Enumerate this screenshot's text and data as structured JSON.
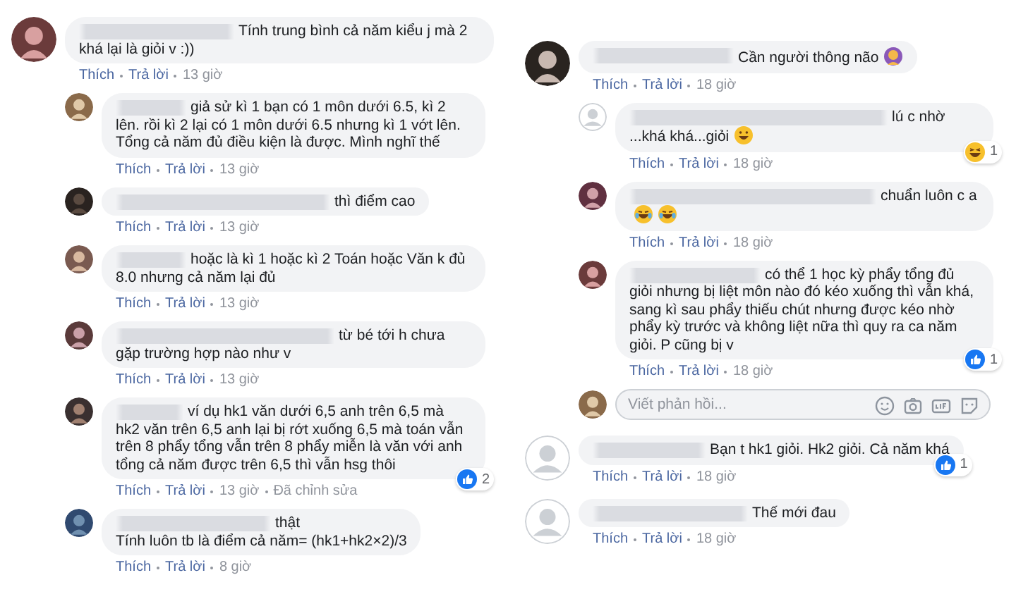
{
  "columns": [
    {
      "comments": [
        {
          "avatar": {
            "kind": "photo"
          },
          "text": "Tính trung bình cả năm kiểu j mà 2 khá lại là giỏi v :))",
          "actions": [
            "Thích",
            "Trả lời"
          ],
          "time": "13 giờ",
          "children": [
            {
              "avatar": {
                "kind": "photo"
              },
              "text": "giả sử kì 1 bạn có 1 môn dưới 6.5, kì 2 lên. rồi kì 2 lại có 1 môn dưới 6.5 nhưng kì 1 vớt lên. Tổng cả năm đủ điều kiện là được. Mình nghĩ thế",
              "actions": [
                "Thích",
                "Trả lời"
              ],
              "time": "13 giờ"
            },
            {
              "avatar": {
                "kind": "photo"
              },
              "text": "thì điểm cao",
              "actions": [
                "Thích",
                "Trả lời"
              ],
              "time": "13 giờ"
            },
            {
              "avatar": {
                "kind": "photo"
              },
              "text": "hoặc là kì 1 hoặc kì 2 Toán hoặc Văn k đủ 8.0 nhưng cả năm lại đủ",
              "actions": [
                "Thích",
                "Trả lời"
              ],
              "time": "13 giờ"
            },
            {
              "avatar": {
                "kind": "photo"
              },
              "text": "từ bé tới h chưa gặp trường hợp nào như v",
              "actions": [
                "Thích",
                "Trả lời"
              ],
              "time": "13 giờ"
            },
            {
              "avatar": {
                "kind": "photo"
              },
              "text": "ví dụ hk1 văn dưới 6,5 anh trên 6,5 mà hk2 văn trên 6,5 anh lại bị rớt xuống 6,5 mà toán vẫn trên 8 phẩy tổng vẫn trên 8 phẩy miễn là văn với anh tổng cả năm được trên 6,5 thì vẫn hsg thôi",
              "actions": [
                "Thích",
                "Trả lời"
              ],
              "time": "13 giờ",
              "edited": "Đã chỉnh sửa",
              "reaction": {
                "kind": "like",
                "count": "2"
              }
            },
            {
              "avatar": {
                "kind": "photo"
              },
              "text": "thật",
              "text2": "Tính luôn tb là điểm cả năm= (hk1+hk2×2)/3",
              "actions": [
                "Thích",
                "Trả lời"
              ],
              "time": "8 giờ"
            }
          ]
        }
      ]
    },
    {
      "comments": [
        {
          "avatar": {
            "kind": "photo"
          },
          "text": "Cần người thông não",
          "emojis": [
            {
              "kind": "person"
            }
          ],
          "actions": [
            "Thích",
            "Trả lời"
          ],
          "time": "18 giờ",
          "children": [
            {
              "avatar": {
                "kind": "default"
              },
              "text": "lú c nhờ ...khá khá...giỏi",
              "emojis": [
                {
                  "kind": "grin"
                }
              ],
              "actions": [
                "Thích",
                "Trả lời"
              ],
              "time": "18 giờ",
              "reaction": {
                "kind": "haha",
                "count": "1"
              }
            },
            {
              "avatar": {
                "kind": "photo"
              },
              "text": "chuẩn luôn c a",
              "emojis": [
                {
                  "kind": "laugh"
                },
                {
                  "kind": "laugh"
                }
              ],
              "actions": [
                "Thích",
                "Trả lời"
              ],
              "time": "18 giờ"
            },
            {
              "avatar": {
                "kind": "photo"
              },
              "text": "có thể 1 học kỳ phẩy tổng đủ giỏi nhưng bị liệt môn nào đó kéo xuống thì vẫn khá, sang kì sau phẩy thiếu chút nhưng được kéo nhờ phẩy kỳ trước và không liệt nữa thì quy ra ca năm giỏi. P cũng bị v",
              "actions": [
                "Thích",
                "Trả lời"
              ],
              "time": "18 giờ",
              "reaction": {
                "kind": "like",
                "count": "1"
              }
            }
          ],
          "reply_box": {
            "placeholder": "Viết phản hồi..."
          }
        },
        {
          "avatar": {
            "kind": "default"
          },
          "text": "Bạn t hk1 giỏi. Hk2 giỏi. Cả năm khá",
          "actions": [
            "Thích",
            "Trả lời"
          ],
          "time": "18 giờ",
          "reaction": {
            "kind": "like",
            "count": "1"
          }
        },
        {
          "avatar": {
            "kind": "default"
          },
          "text": "Thế mới đau",
          "actions": [
            "Thích",
            "Trả lời"
          ],
          "time": "18 giờ"
        }
      ]
    }
  ]
}
